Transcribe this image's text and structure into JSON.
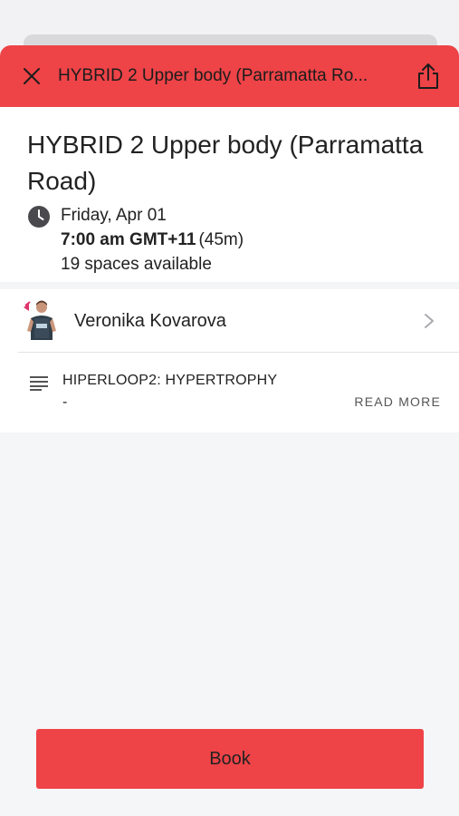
{
  "header": {
    "title": "HYBRID 2 Upper body (Parramatta Ro...",
    "close_icon": "close-icon",
    "share_icon": "share-icon",
    "accent_color": "#ee4347"
  },
  "class_info": {
    "title": "HYBRID 2 Upper body (Parramatta Road)",
    "date": "Friday, Apr 01",
    "time": "7:00 am GMT+11",
    "duration": "(45m)",
    "spaces": "19 spaces available"
  },
  "instructor": {
    "name": "Veronika Kovarova"
  },
  "description": {
    "title": "HIPERLOOP2: HYPERTROPHY",
    "text": "-",
    "read_more": "READ MORE"
  },
  "actions": {
    "book_label": "Book"
  }
}
